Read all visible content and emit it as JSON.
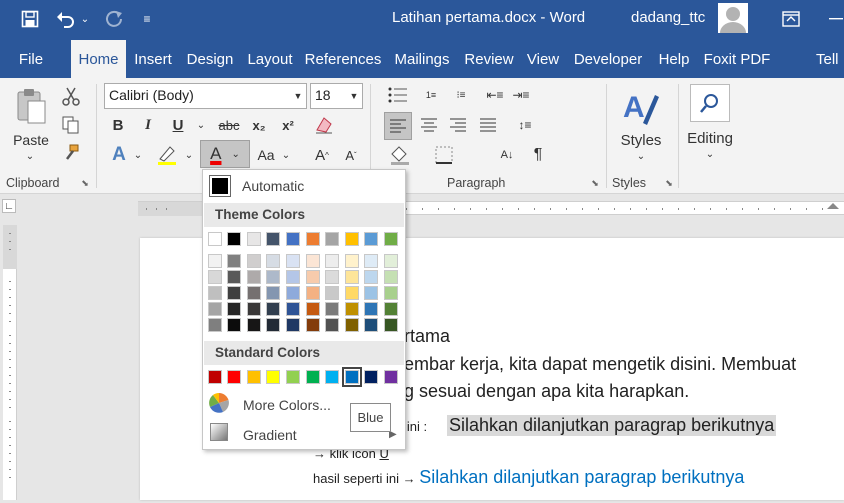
{
  "title_bar": {
    "doc_title": "Latihan pertama.docx  -  Word",
    "user": "dadang_ttc"
  },
  "menu": {
    "tabs": [
      "File",
      "Home",
      "Insert",
      "Design",
      "Layout",
      "References",
      "Mailings",
      "Review",
      "View",
      "Developer",
      "Help",
      "Foxit PDF",
      "Tell"
    ],
    "active": "Home"
  },
  "ribbon": {
    "clipboard": {
      "paste_label": "Paste",
      "group_label": "Clipboard"
    },
    "font": {
      "name": "Calibri (Body)",
      "size": "18",
      "bold": "B",
      "italic": "I",
      "underline": "U",
      "strike": "abc",
      "sub": "x₂",
      "sup": "x²",
      "case": "Aa",
      "font_color_letter": "A"
    },
    "paragraph": {
      "group_label": "Paragraph"
    },
    "styles": {
      "label": "Styles",
      "group_label": "Styles"
    },
    "editing": {
      "label": "Editing"
    }
  },
  "document": {
    "line1": "rtama",
    "line2": "embar kerja, kita dapat mengetik disini. Membuat",
    "line3": "g sesuai dengan apa kita harapkan.",
    "line4_prefix": "n ini :",
    "line4_highlight": "Silahkan dilanjutkan paragrap berikutnya",
    "line5": "→ klik icon ",
    "line5_u": "U",
    "line6_prefix": "hasil seperti ini → ",
    "line6_blue": "Silahkan dilanjutkan paragrap berikutnya"
  },
  "font_color_menu": {
    "automatic": "Automatic",
    "theme_header": "Theme Colors",
    "standard_header": "Standard Colors",
    "more_colors": "More Colors...",
    "gradient": "Gradient",
    "theme_colors": [
      "#ffffff",
      "#000000",
      "#e7e6e6",
      "#44546a",
      "#4472c4",
      "#ed7d31",
      "#a5a5a5",
      "#ffc000",
      "#5b9bd5",
      "#70ad47"
    ],
    "theme_shades": [
      [
        "#f2f2f2",
        "#808080",
        "#d0cece",
        "#d6dce4",
        "#d9e2f3",
        "#fbe5d5",
        "#ededed",
        "#fff2cc",
        "#deebf6",
        "#e2efd9"
      ],
      [
        "#d8d8d8",
        "#595959",
        "#aeaaaa",
        "#adb9ca",
        "#b4c6e7",
        "#f7cbac",
        "#dbdbdb",
        "#fee599",
        "#bdd7ee",
        "#c5e0b3"
      ],
      [
        "#bfbfbf",
        "#3f3f3f",
        "#757070",
        "#8496b0",
        "#8eaadb",
        "#f4b183",
        "#c9c9c9",
        "#ffd965",
        "#9cc3e5",
        "#a8d08d"
      ],
      [
        "#a5a5a5",
        "#262626",
        "#3a3838",
        "#323f4f",
        "#2f5496",
        "#c55a11",
        "#7b7b7b",
        "#bf9000",
        "#2e75b5",
        "#538135"
      ],
      [
        "#7f7f7f",
        "#0c0c0c",
        "#171616",
        "#222a35",
        "#1f3864",
        "#833c0b",
        "#525252",
        "#7f6000",
        "#1e4e79",
        "#375623"
      ]
    ],
    "standard_colors": [
      "#c00000",
      "#ff0000",
      "#ffc000",
      "#ffff00",
      "#92d050",
      "#00b050",
      "#00b0f0",
      "#0070c0",
      "#002060",
      "#7030a0"
    ],
    "tooltip": "Blue"
  }
}
